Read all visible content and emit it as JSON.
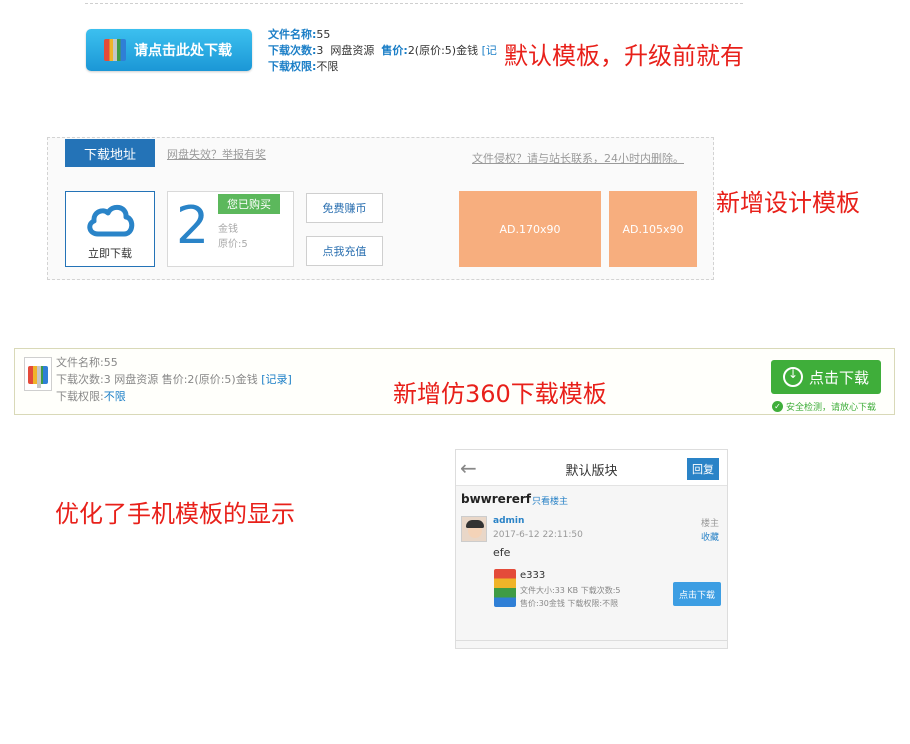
{
  "section_default": {
    "download_button": "请点击此处下载",
    "name_label": "文件名称:",
    "name_value": "55",
    "downloads_label": "下载次数:",
    "downloads_value": "3",
    "source": "网盘资源",
    "price_label": "售价:",
    "price_value": "2(原价:5)金钱",
    "record_link": "[记",
    "permission_label": "下载权限:",
    "permission_value": "不限",
    "note": "默认模板，升级前就有"
  },
  "section_design": {
    "tab_label": "下载地址",
    "report_link": "网盘失效？举报有奖",
    "copyright_link": "文件侵权？请与站长联系，24小时内删除。",
    "cloud_label": "立即下载",
    "price_number": "2",
    "bought_badge": "您已购买",
    "currency": "金钱",
    "original_price": "原价:5",
    "earn_button": "免费赚币",
    "recharge_button": "点我充值",
    "ad1": "AD.170x90",
    "ad2": "AD.105x90",
    "note": "新增设计模板"
  },
  "section_360": {
    "name_line": "文件名称:55",
    "downloads_line": "下载次数:3  网盘资源  售价:2(原价:5)金钱",
    "record_link": "[记录]",
    "permission_label": "下载权限:",
    "permission_value": "不限",
    "download_button": "点击下载",
    "safe_text": "安全检测，请放心下载",
    "note": "新增仿360下载模板"
  },
  "section_mobile": {
    "note": "优化了手机模板的显示",
    "header_title": "默认版块",
    "reply_button": "回复",
    "thread_title": "bwwrererf",
    "only_author": "只看楼主",
    "username": "admin",
    "post_date": "2017-6-12 22:11:50",
    "floor_label": "楼主",
    "favorite_label": "收藏",
    "post_body": "efe",
    "file_name": "e333",
    "file_meta_1": "文件大小:33 KB   下载次数:5",
    "file_meta_2": "售价:30金钱   下载权限:不限",
    "download_button": "点击下载"
  },
  "colors": {
    "accent_blue": "#2473b7",
    "note_red": "#e8201a",
    "ad_orange": "#f7ae7e",
    "green": "#3fae3a"
  }
}
